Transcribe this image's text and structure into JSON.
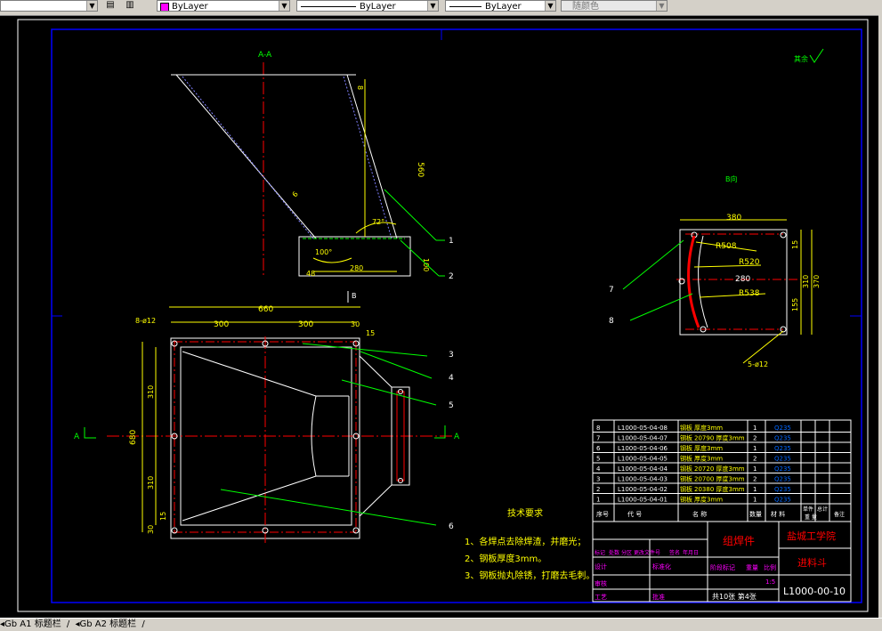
{
  "toolbar": {
    "color_combo": "ByLayer",
    "linetype_combo": "ByLayer",
    "lineweight_combo": "ByLayer",
    "plotstyle_combo": "随颜色",
    "color_swatch": "#ff00ff"
  },
  "drawing": {
    "section_title": "A-A",
    "view_b_label": "B向",
    "roughness_note": "其余",
    "arrow_b": "B",
    "arrow_a_left": "A",
    "arrow_a_right": "A",
    "section_dims": {
      "d560": "560",
      "d8": "8",
      "d72": "72°",
      "d100deg": "100°",
      "d100": "100",
      "d280": "280",
      "d48": "48",
      "d6": "6"
    },
    "plan_dims": {
      "d660": "660",
      "d300a": "300",
      "d300b": "300",
      "d30a": "30",
      "d15a": "15",
      "holes": "8-ø12",
      "d310a": "310",
      "d310b": "310",
      "d680": "680",
      "d15b": "15",
      "d30b": "30"
    },
    "bview_dims": {
      "d380": "380",
      "r508": "R508",
      "r520": "R520",
      "d280": "280",
      "r538": "R538",
      "d15": "15",
      "d155": "155",
      "d310": "310",
      "d370": "370",
      "holes": "5-ø12"
    },
    "balloons": [
      "1",
      "2",
      "3",
      "4",
      "5",
      "6",
      "7",
      "8"
    ],
    "tech_req_title": "技术要求",
    "tech_reqs": [
      "1、各焊点去除焊渣，并磨光；",
      "2、钢板厚度3mm。",
      "3、钢板抛丸除锈，打磨去毛刺。"
    ]
  },
  "bom": {
    "rows": [
      {
        "no": "8",
        "code": "L1000-05-04-08",
        "name": "钢板",
        "spec": "厚度3mm",
        "qty": "1",
        "mat": "Q235"
      },
      {
        "no": "7",
        "code": "L1000-05-04-07",
        "name": "钢板",
        "spec": "20790  厚度3mm",
        "qty": "2",
        "mat": "Q235"
      },
      {
        "no": "6",
        "code": "L1000-05-04-06",
        "name": "钢板",
        "spec": "厚度3mm",
        "qty": "1",
        "mat": "Q235"
      },
      {
        "no": "5",
        "code": "L1000-05-04-05",
        "name": "钢板",
        "spec": "厚度3mm",
        "qty": "2",
        "mat": "Q235"
      },
      {
        "no": "4",
        "code": "L1000-05-04-04",
        "name": "钢板",
        "spec": "20720  厚度3mm",
        "qty": "1",
        "mat": "Q235"
      },
      {
        "no": "3",
        "code": "L1000-05-04-03",
        "name": "钢板",
        "spec": "20700  厚度3mm",
        "qty": "2",
        "mat": "Q235"
      },
      {
        "no": "2",
        "code": "L1000-05-04-02",
        "name": "钢板",
        "spec": "20380  厚度3mm",
        "qty": "1",
        "mat": "Q235"
      },
      {
        "no": "1",
        "code": "L1000-05-04-01",
        "name": "钢板",
        "spec": "厚度3mm",
        "qty": "1",
        "mat": "Q235"
      }
    ],
    "header": {
      "no": "序号",
      "code": "代    号",
      "name": "名    称",
      "qty": "数量",
      "mat": "材    料",
      "unit_w": "单件",
      "total_w": "总计",
      "weight": "重  量",
      "remark": "备注"
    }
  },
  "title_block": {
    "drawing_type": "组焊件",
    "school": "盐城工学院",
    "part_name": "进料斗",
    "drawing_no": "L1000-00-10",
    "scale_label": "比例",
    "scale": "1:5",
    "stage_label": "阶段标记",
    "weight_label": "重量",
    "sheets": "共10张  第4张",
    "design": "设计",
    "check": "审核",
    "process": "工艺",
    "standard": "标准化",
    "approve": "批准",
    "mark": "标记",
    "count": "处数",
    "zone": "分区",
    "change_no": "更改文件号",
    "sign": "签名",
    "date": "年月日"
  },
  "status_tabs": [
    "Gb A1 标题栏",
    "Gb A2 标题栏"
  ]
}
